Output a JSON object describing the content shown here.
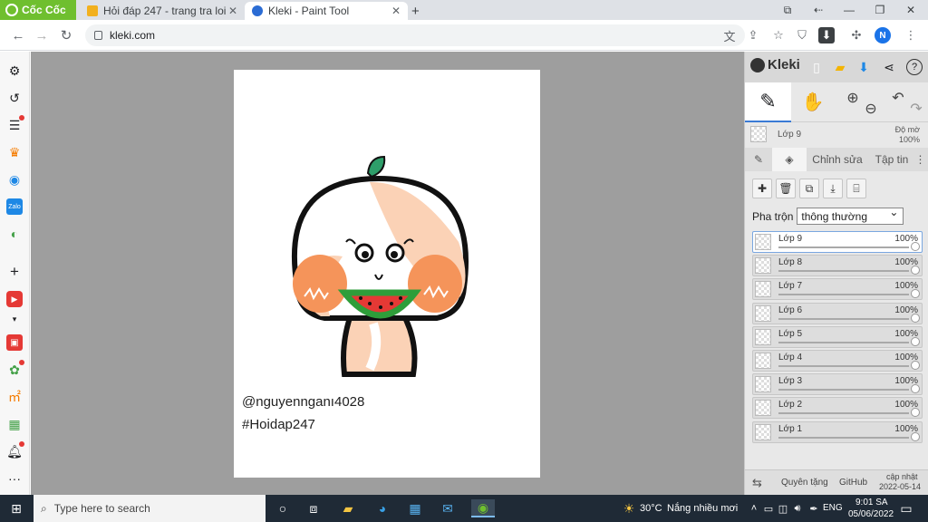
{
  "browser": {
    "brand": "Cốc Cốc",
    "tabs": [
      {
        "title": "Hỏi đáp 247 - trang tra loi",
        "active": false
      },
      {
        "title": "Kleki - Paint Tool",
        "active": true
      }
    ],
    "new_tab": "+",
    "url": "kleki.com",
    "profile_initial": "N"
  },
  "canvas": {
    "signature_line1": "@nguyennganı4028",
    "signature_line2": "#Hoidap247"
  },
  "panel": {
    "app_name": "Kleki",
    "current_layer": "Lớp 9",
    "opacity_label": "Độ mờ",
    "opacity_value": "100%",
    "tabs": [
      "Chỉnh sửa",
      "Tập tin"
    ],
    "blend_label": "Pha trộn",
    "blend_value": "thông thường",
    "layers": [
      {
        "name": "Lớp 9",
        "opacity": "100%",
        "selected": true
      },
      {
        "name": "Lớp 8",
        "opacity": "100%",
        "selected": false
      },
      {
        "name": "Lớp 7",
        "opacity": "100%",
        "selected": false
      },
      {
        "name": "Lớp 6",
        "opacity": "100%",
        "selected": false
      },
      {
        "name": "Lớp 5",
        "opacity": "100%",
        "selected": false
      },
      {
        "name": "Lớp 4",
        "opacity": "100%",
        "selected": false
      },
      {
        "name": "Lớp 3",
        "opacity": "100%",
        "selected": false
      },
      {
        "name": "Lớp 2",
        "opacity": "100%",
        "selected": false
      },
      {
        "name": "Lớp 1",
        "opacity": "100%",
        "selected": false
      }
    ],
    "footer": {
      "credits": "Quyên tặng",
      "github": "GitHub",
      "update_label": "cập nhật",
      "update_date": "2022-05-14"
    }
  },
  "taskbar": {
    "search_placeholder": "Type here to search",
    "weather_temp": "30°C",
    "weather_desc": "Nắng nhiều mơi",
    "lang": "ENG",
    "time": "9:01 SA",
    "date": "05/06/2022"
  }
}
